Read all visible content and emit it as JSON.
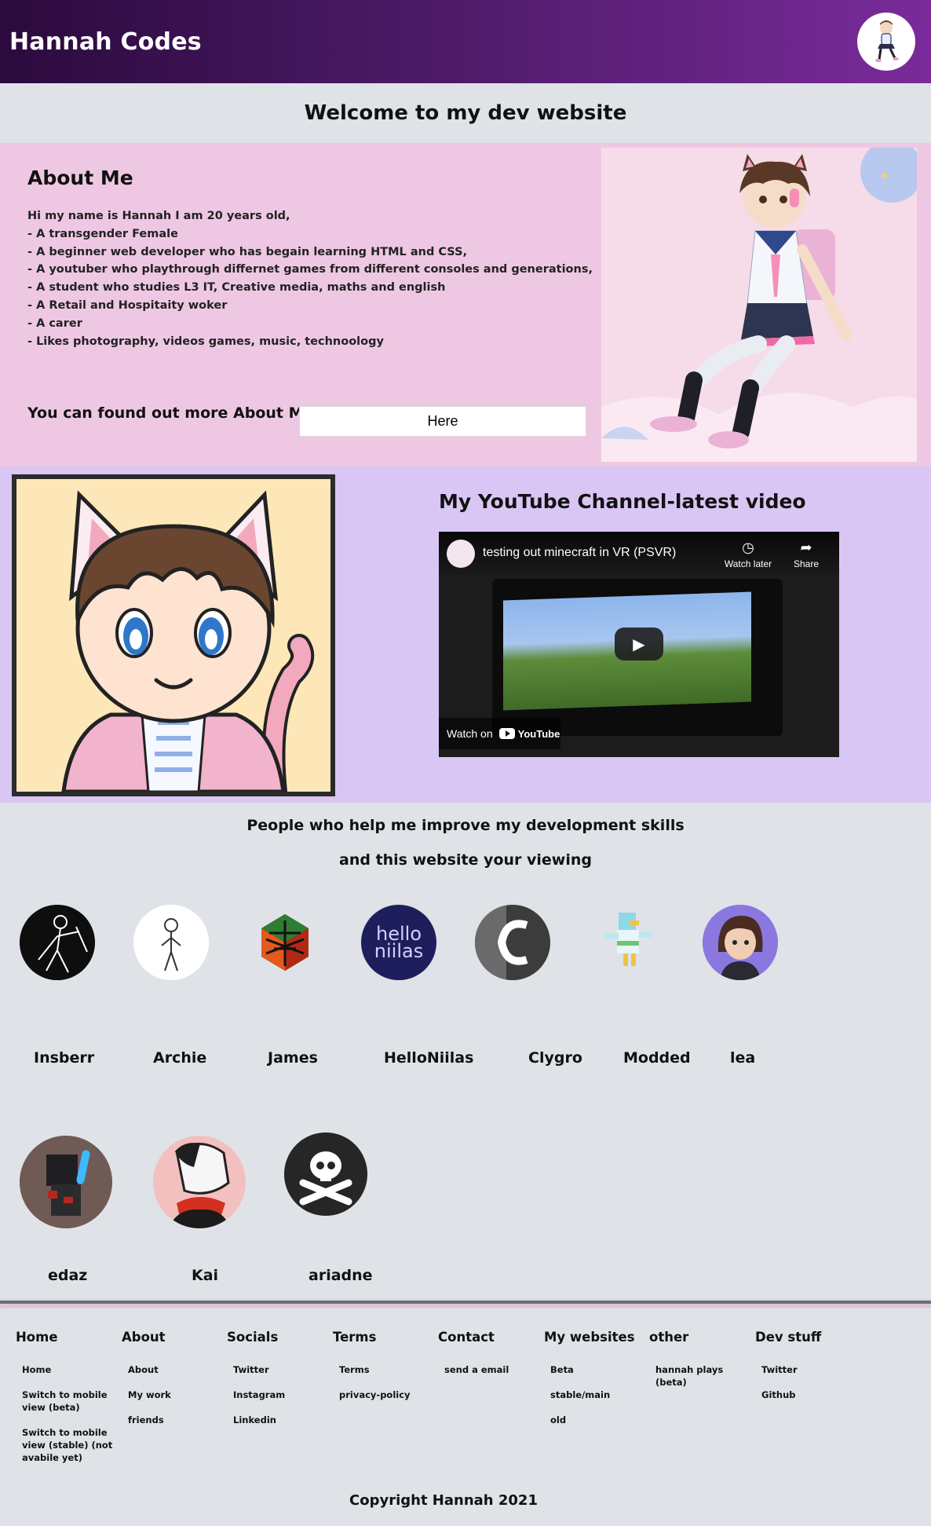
{
  "header": {
    "site_title": "Hannah Codes",
    "avatar_icon": "profile-avatar"
  },
  "welcome": {
    "heading": "Welcome to my dev website"
  },
  "about": {
    "title": "About Me",
    "lines": [
      "Hi my name is Hannah I am 20 years old,",
      "- A transgender Female",
      "- A beginner web developer who has begain learning HTML and CSS,",
      "- A youtuber who playthrough differnet games from different consoles and generations,",
      "- A student who studies L3 IT, Creative media, maths and english",
      "- A Retail and Hospitaity woker",
      "- A carer",
      "- Likes photography, videos games, music, technoology"
    ],
    "more_text": "You can found out more About Me",
    "here_button": "Here",
    "bg_color": "#eec8e2"
  },
  "youtube": {
    "title": "My YouTube Channel-latest video",
    "video_title": "testing out minecraft in VR (PSVR)",
    "watch_later": "Watch later",
    "share": "Share",
    "watch_on": "Watch on",
    "logo_text": "YouTube",
    "bg_color": "#d9c6f4"
  },
  "helpers": {
    "heading_line1": "People who help me improve my development skills",
    "heading_line2": "and this website your viewing",
    "people": [
      {
        "name": "Insberr"
      },
      {
        "name": "Archie"
      },
      {
        "name": "James"
      },
      {
        "name": "HelloNiilas",
        "avatar_text_1": "hello",
        "avatar_text_2": "niilas"
      },
      {
        "name": "Clygro"
      },
      {
        "name": "Modded"
      },
      {
        "name": "lea"
      },
      {
        "name": "edaz"
      },
      {
        "name": "Kai"
      },
      {
        "name": "ariadne"
      }
    ]
  },
  "footer": {
    "columns": [
      {
        "title": "Home",
        "links": [
          "Home",
          "Switch to mobile view (beta)",
          "Switch to mobile view (stable) (not avabile yet)"
        ]
      },
      {
        "title": "About",
        "links": [
          "About",
          "My work",
          "friends"
        ]
      },
      {
        "title": "Socials",
        "links": [
          "Twitter",
          "Instagram",
          "Linkedin"
        ]
      },
      {
        "title": "Terms",
        "links": [
          "Terms",
          "privacy-policy"
        ]
      },
      {
        "title": "Contact",
        "links": [
          "send a email"
        ]
      },
      {
        "title": "My websites",
        "links": [
          "Beta",
          "stable/main",
          "old"
        ]
      },
      {
        "title": "other",
        "links": [
          "hannah plays (beta)"
        ]
      },
      {
        "title": "Dev stuff",
        "links": [
          "Twitter",
          "Github"
        ]
      }
    ],
    "copyright": "Copyright Hannah 2021"
  }
}
